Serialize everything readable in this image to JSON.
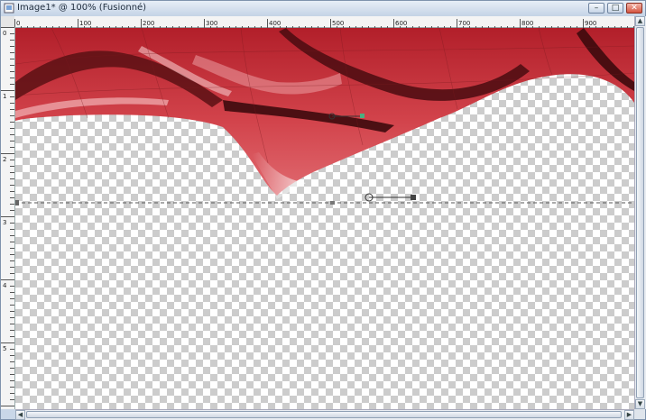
{
  "window": {
    "title": "Image1* @ 100% (Fusionné)",
    "controls": {
      "minimize": "–",
      "maximize": "□",
      "close": "✕"
    }
  },
  "ruler": {
    "top_labels": [
      "0",
      "100",
      "200",
      "300",
      "400",
      "500",
      "600",
      "700",
      "800",
      "900"
    ],
    "left_labels": [
      "0",
      "1",
      "2",
      "3",
      "4",
      "5"
    ]
  },
  "canvas": {
    "layer_fill": "#c8333b",
    "checker_light": "#ffffff",
    "checker_dark": "#cccccc"
  },
  "icons": {
    "app": "image-document-icon",
    "rotation_handle": "crosshair-circle-icon"
  }
}
